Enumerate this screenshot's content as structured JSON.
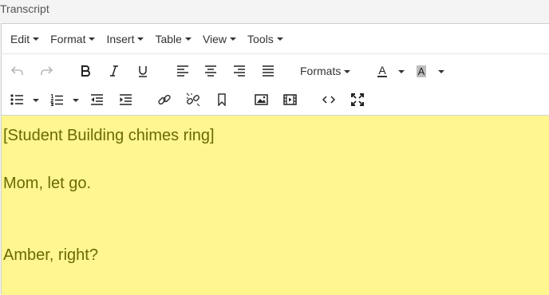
{
  "field": {
    "label": "Transcript"
  },
  "menubar": {
    "items": [
      {
        "label": "Edit"
      },
      {
        "label": "Format"
      },
      {
        "label": "Insert"
      },
      {
        "label": "Table"
      },
      {
        "label": "View"
      },
      {
        "label": "Tools"
      }
    ]
  },
  "toolbar": {
    "formats_label": "Formats",
    "icons_row1": [
      "undo-icon",
      "redo-icon",
      "bold-icon",
      "italic-icon",
      "underline-icon",
      "align-left-icon",
      "align-center-icon",
      "align-right-icon",
      "align-justify-icon",
      "text-color-icon",
      "background-color-icon"
    ],
    "icons_row2": [
      "bullet-list-icon",
      "numbered-list-icon",
      "outdent-icon",
      "indent-icon",
      "link-icon",
      "unlink-icon",
      "bookmark-icon",
      "image-icon",
      "media-icon",
      "source-code-icon",
      "fullscreen-icon"
    ],
    "text_color_glyph": "A",
    "background_color_glyph": "A",
    "colors": {
      "text_color_underline": "#333333",
      "background_color_swatch": "#bdbdbd"
    }
  },
  "content": {
    "background": "#fff68f",
    "text_color": "#6b6a00",
    "lines": [
      "[Student Building chimes ring]",
      "Mom, let go.",
      "Amber, right?"
    ]
  }
}
